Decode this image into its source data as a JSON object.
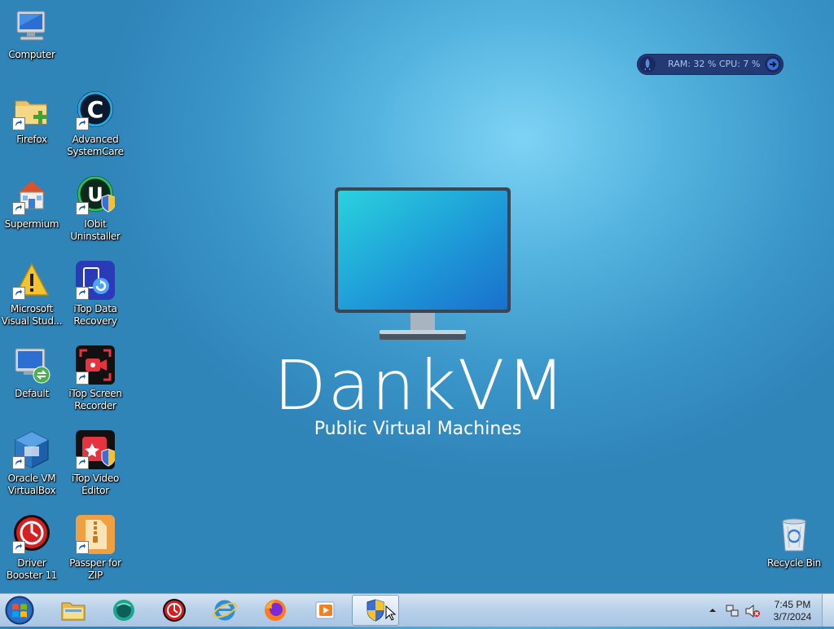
{
  "desktop": {
    "icons": [
      {
        "label": "Computer"
      },
      {
        "label": "Firefox"
      },
      {
        "label": "Advanced SystemCare"
      },
      {
        "label": "Supermium"
      },
      {
        "label": "IObit Uninstaller"
      },
      {
        "label": "Microsoft Visual Stud..."
      },
      {
        "label": "iTop Data Recovery"
      },
      {
        "label": "Default"
      },
      {
        "label": "iTop Screen Recorder"
      },
      {
        "label": "Oracle VM VirtualBox"
      },
      {
        "label": "iTop Video Editor"
      },
      {
        "label": "Driver Booster 11"
      },
      {
        "label": "Passper for ZIP"
      },
      {
        "label": "Recycle Bin"
      }
    ]
  },
  "widget": {
    "text": "RAM: 32 %    CPU: 7 %"
  },
  "wallpaper": {
    "brand": "DankVM",
    "tagline": "Public Virtual Machines"
  },
  "taskbar": {
    "items": [
      "start-orb",
      "file-explorer",
      "app-teal",
      "driver-booster",
      "internet-explorer",
      "firefox",
      "media-player",
      "shield-app"
    ]
  },
  "tray": {
    "time": "7:45 PM",
    "date": "3/7/2024"
  },
  "colors": {
    "taskbar": "#b9d1ea",
    "widget": "#233a74",
    "wallpaper": "#4aa6d6"
  }
}
